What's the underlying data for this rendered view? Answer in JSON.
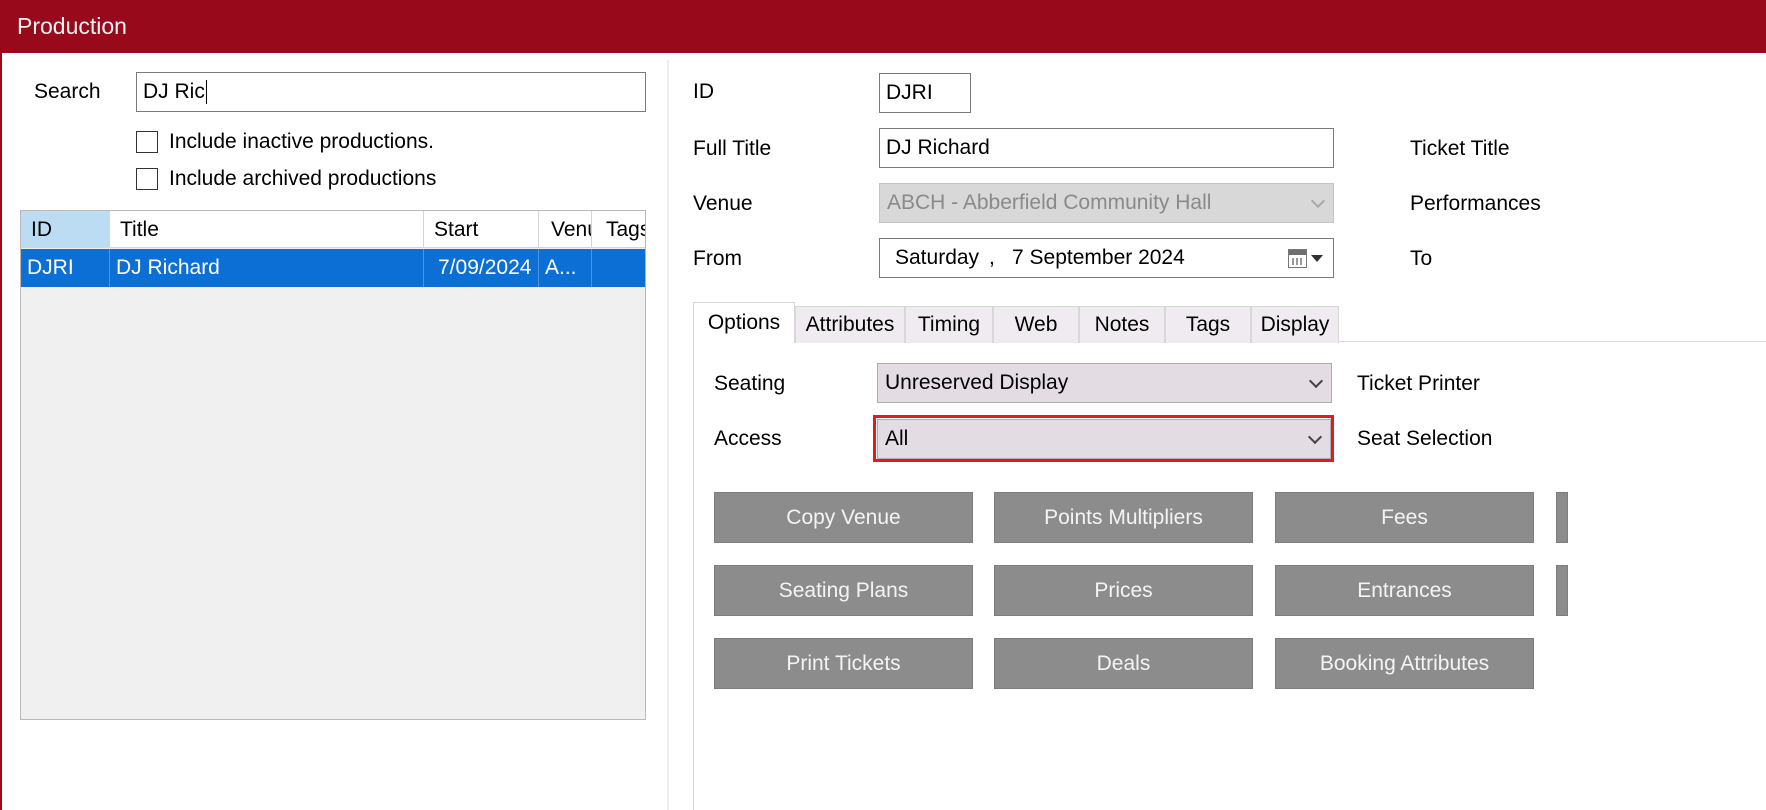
{
  "window": {
    "title": "Production"
  },
  "search": {
    "label": "Search",
    "value": "DJ Ric",
    "include_inactive": "Include inactive productions.",
    "include_archived": "Include archived productions"
  },
  "grid": {
    "columns": [
      "ID",
      "Title",
      "Start",
      "Venu",
      "Tags"
    ],
    "rows": [
      {
        "id": "DJRI",
        "title": "DJ Richard",
        "start": "7/09/2024",
        "venue": "A...",
        "tags": ""
      }
    ]
  },
  "form": {
    "id_label": "ID",
    "id_value": "DJRI",
    "full_title_label": "Full Title",
    "full_title_value": "DJ Richard",
    "venue_label": "Venue",
    "venue_value": "ABCH - Abberfield Community Hall",
    "from_label": "From",
    "from_day": "Saturday",
    "from_sep": ",",
    "from_date": "7 September 2024",
    "ticket_title_label": "Ticket Title",
    "performances_label": "Performances",
    "to_label": "To"
  },
  "tabs": [
    "Options",
    "Attributes",
    "Timing",
    "Web",
    "Notes",
    "Tags",
    "Display"
  ],
  "options": {
    "seating_label": "Seating",
    "seating_value": "Unreserved Display",
    "access_label": "Access",
    "access_value": "All",
    "ticket_printer_label": "Ticket Printer",
    "seat_selection_label": "Seat Selection"
  },
  "buttons": [
    "Copy Venue",
    "Points Multipliers",
    "Fees",
    "Seating Plans",
    "Prices",
    "Entrances",
    "Print Tickets",
    "Deals",
    "Booking Attributes"
  ],
  "colors": {
    "titlebar": "#99091c",
    "selection": "#0b6fd6",
    "button": "#8c8c8c",
    "highlight": "#e01b24"
  }
}
